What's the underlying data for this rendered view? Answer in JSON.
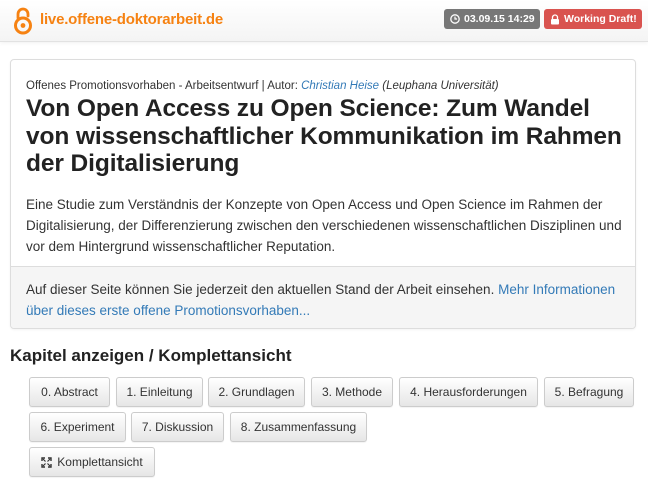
{
  "header": {
    "site_link": "live.offene-doktorarbeit.de",
    "date_badge": "03.09.15 14:29",
    "status_badge": "Working Draft!"
  },
  "colors": {
    "brand_orange": "#f68212",
    "link_blue": "#337ab7",
    "draft_red": "#d9534f",
    "badge_gray": "#777777"
  },
  "intro": {
    "meta_prefix": "Offenes Promotionsvorhaben - Arbeitsentwurf | Autor: ",
    "author": "Christian Heise",
    "affiliation": " (Leuphana Universität)",
    "title": "Von Open Access zu Open Science: Zum Wandel von wissenschaftlicher Kommunikation im Rahmen der Digitalisierung",
    "abstract": "Eine Studie zum Verständnis der Konzepte von Open Access und Open Science im Rahmen der Digitalisierung, der Differenzierung zwischen den verschiedenen wissenschaftlichen Disziplinen und vor dem Hintergrund wissenschaftlicher Reputation.",
    "footer_text": "Auf dieser Seite können Sie jederzeit den aktuellen Stand der Arbeit einsehen. ",
    "footer_link": "Mehr Informationen über dieses erste offene Promotionsvorhaben..."
  },
  "chapters": {
    "heading": "Kapitel anzeigen / Komplettansicht",
    "buttons": [
      "0. Abstract",
      "1. Einleitung",
      "2. Grundlagen",
      "3. Methode",
      "4. Herausforderungen",
      "5. Befragung",
      "6. Experiment",
      "7. Diskussion",
      "8. Zusammenfassung"
    ],
    "full_view": "Komplettansicht"
  },
  "icons": {
    "logo": "open-access-lock-icon",
    "date": "clock-icon",
    "draft": "lock-icon",
    "full_view": "expand-icon"
  }
}
